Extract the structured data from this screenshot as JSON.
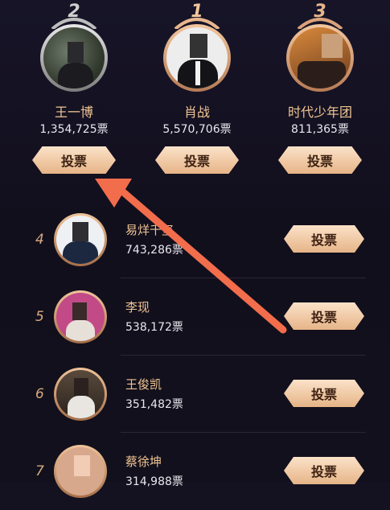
{
  "podium": [
    {
      "rank": "2",
      "name": "王一博",
      "votes": "1,354,725票",
      "button": "投票"
    },
    {
      "rank": "1",
      "name": "肖战",
      "votes": "5,570,706票",
      "button": "投票"
    },
    {
      "rank": "3",
      "name": "时代少年团",
      "votes": "811,365票",
      "button": "投票"
    }
  ],
  "list": [
    {
      "rank": "4",
      "name": "易烊千玺",
      "votes": "743,286票",
      "button": "投票"
    },
    {
      "rank": "5",
      "name": "李现",
      "votes": "538,172票",
      "button": "投票"
    },
    {
      "rank": "6",
      "name": "王俊凯",
      "votes": "351,482票",
      "button": "投票"
    },
    {
      "rank": "7",
      "name": "蔡徐坤",
      "votes": "314,988票",
      "button": "投票"
    }
  ],
  "colors": {
    "accent": "#f0c594",
    "arrow": "#f26d4c",
    "background": "#141220"
  }
}
